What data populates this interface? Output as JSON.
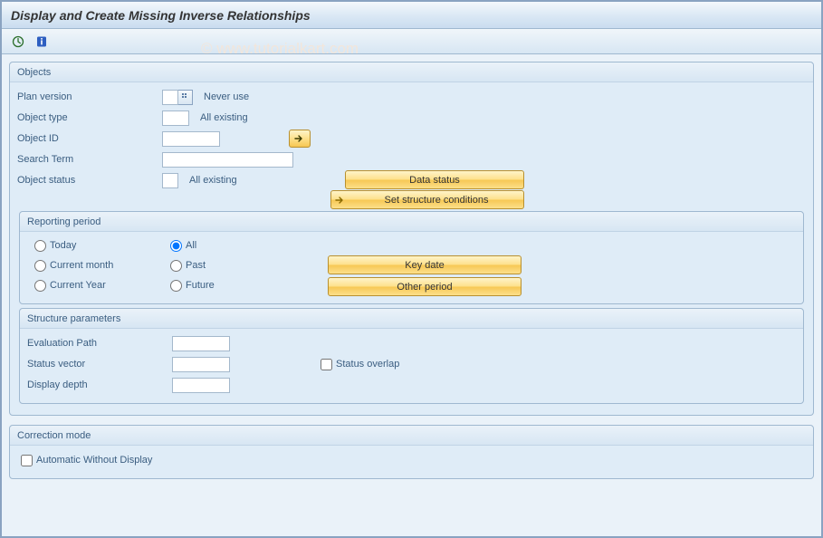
{
  "title": "Display and Create Missing Inverse Relationships",
  "watermark": "© www.tutorialkart.com",
  "groups": {
    "objects": {
      "title": "Objects",
      "fields": {
        "plan_version": {
          "label": "Plan version",
          "after": "Never use"
        },
        "object_type": {
          "label": "Object type",
          "after": "All existing"
        },
        "object_id": {
          "label": "Object ID"
        },
        "search_term": {
          "label": "Search Term"
        },
        "object_status": {
          "label": "Object status",
          "after": "All existing"
        }
      },
      "buttons": {
        "data_status": "Data status",
        "set_structure": "Set structure conditions"
      }
    },
    "period": {
      "title": "Reporting period",
      "radios": {
        "today": "Today",
        "all": "All",
        "cur_month": "Current month",
        "past": "Past",
        "cur_year": "Current Year",
        "future": "Future"
      },
      "buttons": {
        "key_date": "Key date",
        "other_period": "Other period"
      }
    },
    "struct": {
      "title": "Structure parameters",
      "fields": {
        "eval_path": "Evaluation Path",
        "status_vec": "Status vector",
        "display_depth": "Display depth",
        "status_overlap": "Status overlap"
      }
    },
    "correction": {
      "title": "Correction mode",
      "auto_without_display": "Automatic Without Display"
    }
  }
}
